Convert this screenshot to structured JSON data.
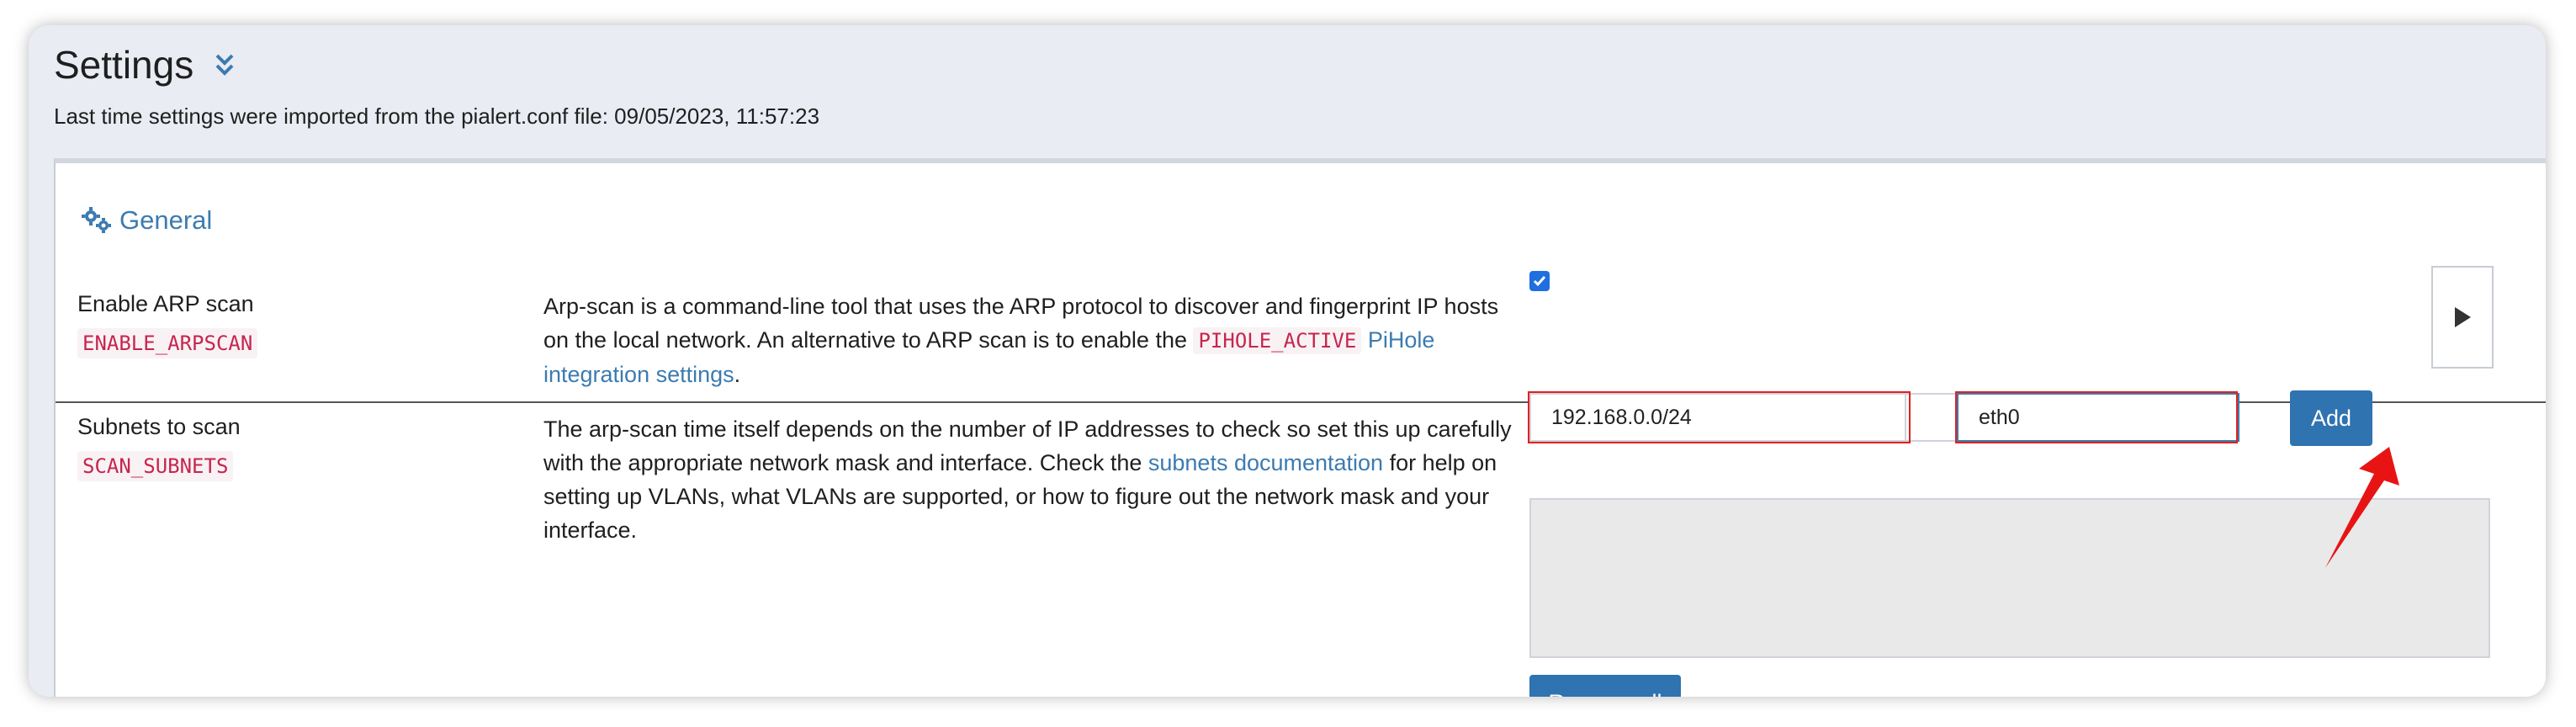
{
  "header": {
    "title": "Settings",
    "expand_icon": "double-chevron-down-icon",
    "last_import": "Last time settings were imported from the pialert.conf file: 09/05/2023, 11:57:23"
  },
  "section": {
    "icon": "gears-icon",
    "title": "General"
  },
  "rows": [
    {
      "label": "Enable ARP scan",
      "code": "ENABLE_ARPSCAN",
      "desc_part1": "Arp-scan is a command-line tool that uses the ARP protocol to discover and fingerprint IP hosts on the local network. An alternative to ARP scan is to enable the ",
      "desc_code": "PIHOLE_ACTIVE",
      "desc_link": "PiHole integration settings",
      "desc_part2": ".",
      "checked": true
    },
    {
      "label": "Subnets to scan",
      "code": "SCAN_SUBNETS",
      "desc_part1": "The arp-scan time itself depends on the number of IP addresses to check so set this up carefully with the appropriate network mask and interface. Check the ",
      "desc_link": "subnets documentation",
      "desc_part2": " for help on setting up VLANs, what VLANs are supported, or how to figure out the network mask and your interface.",
      "subnet_value": "192.168.0.0/24",
      "interface_value": "eth0",
      "add_label": "Add",
      "remove_all_label": "Remove all"
    }
  ],
  "colors": {
    "accent": "#2f73b0",
    "link": "#3c7bb0",
    "code": "#c7254e",
    "highlight": "#e02020"
  }
}
